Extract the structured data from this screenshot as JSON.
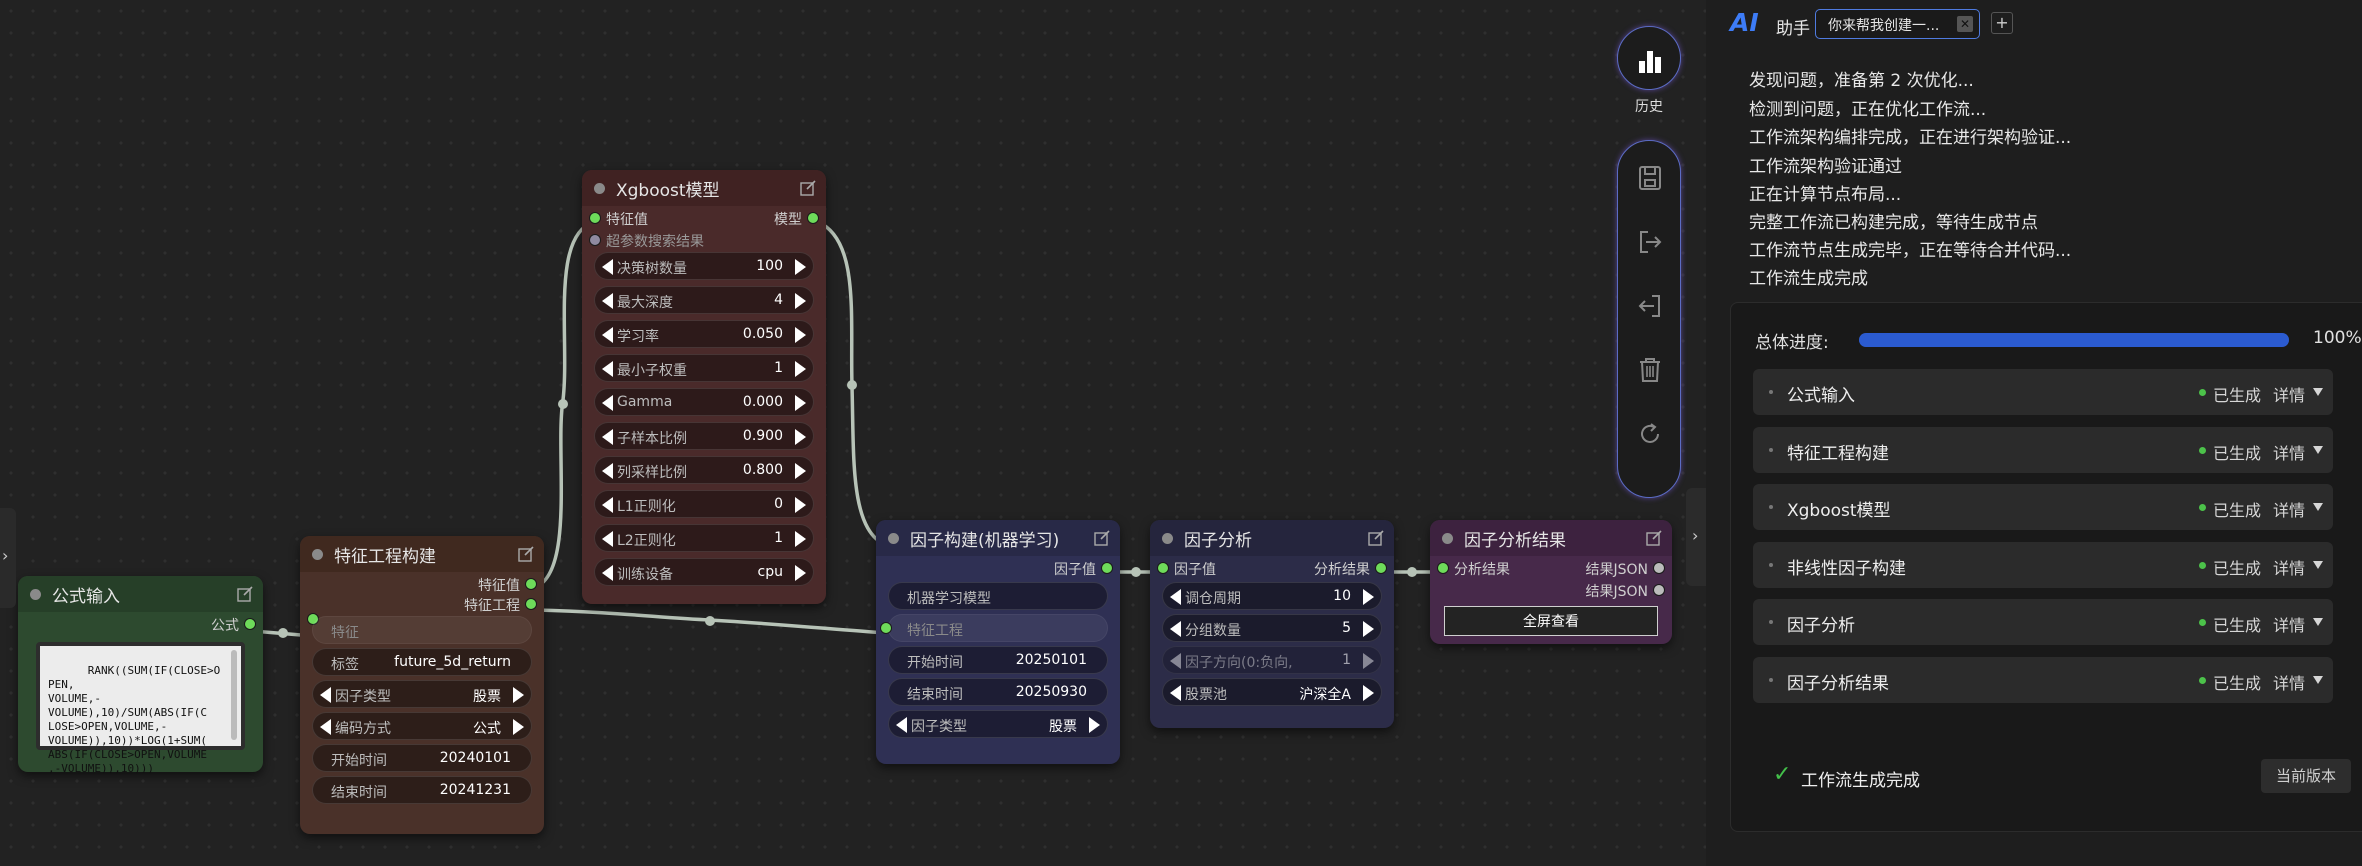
{
  "nodes": {
    "formula_input": {
      "title": "公式输入",
      "output": "公式",
      "formula": "RANK((SUM(IF(CLOSE>OPEN,\nVOLUME,-\nVOLUME),10)/SUM(ABS(IF(C\nLOSE>OPEN,VOLUME,-\nVOLUME)),10))*LOG(1+SUM(\nABS(IF(CLOSE>OPEN,VOLUME\n,-VOLUME)),10)))"
    },
    "feature_eng": {
      "title": "特征工程构建",
      "outputs": [
        "特征值",
        "特征工程"
      ],
      "widgets": [
        {
          "label": "特征",
          "value": ""
        },
        {
          "label": "标签",
          "value": "future_5d_return"
        },
        {
          "label": "因子类型",
          "value": "股票"
        },
        {
          "label": "编码方式",
          "value": "公式"
        },
        {
          "label": "开始时间",
          "value": "20240101"
        },
        {
          "label": "结束时间",
          "value": "20241231"
        }
      ]
    },
    "xgboost": {
      "title": "Xgboost模型",
      "inputs": [
        "特征值",
        "超参数搜索结果"
      ],
      "output": "模型",
      "widgets": [
        {
          "label": "决策树数量",
          "value": "100"
        },
        {
          "label": "最大深度",
          "value": "4"
        },
        {
          "label": "学习率",
          "value": "0.050"
        },
        {
          "label": "最小子权重",
          "value": "1"
        },
        {
          "label": "Gamma",
          "value": "0.000"
        },
        {
          "label": "子样本比例",
          "value": "0.900"
        },
        {
          "label": "列采样比例",
          "value": "0.800"
        },
        {
          "label": "L1正则化",
          "value": "0"
        },
        {
          "label": "L2正则化",
          "value": "1"
        },
        {
          "label": "训练设备",
          "value": "cpu"
        }
      ]
    },
    "factor_build": {
      "title": "因子构建(机器学习)",
      "output": "因子值",
      "widgets": [
        {
          "label": "机器学习模型",
          "value": ""
        },
        {
          "label": "特征工程",
          "value": ""
        },
        {
          "label": "开始时间",
          "value": "20250101"
        },
        {
          "label": "结束时间",
          "value": "20250930"
        },
        {
          "label": "因子类型",
          "value": "股票"
        }
      ]
    },
    "factor_analysis": {
      "title": "因子分析",
      "input": "因子值",
      "output": "分析结果",
      "widgets": [
        {
          "label": "调仓周期",
          "value": "10"
        },
        {
          "label": "分组数量",
          "value": "5"
        },
        {
          "label": "因子方向(0:负向,",
          "value": "1"
        },
        {
          "label": "股票池",
          "value": "沪深全A"
        }
      ]
    },
    "factor_result": {
      "title": "因子分析结果",
      "input": "分析结果",
      "outputs": [
        "结果JSON",
        "结果JSON"
      ],
      "button": "全屏查看"
    }
  },
  "toolbar": {
    "history_label": "历史",
    "icons": [
      "save-icon",
      "export-icon",
      "import-icon",
      "trash-icon",
      "refresh-icon"
    ]
  },
  "panel": {
    "logo": "AI",
    "title": "助手",
    "tab_label": "你来帮我创建一...",
    "tab_close": "✕",
    "add_tab": "+",
    "log": [
      "发现问题，准备第 2 次优化...",
      "检测到问题，正在优化工作流...",
      "工作流架构编排完成，正在进行架构验证...",
      "工作流架构验证通过",
      "正在计算节点布局...",
      "完整工作流已构建完成，等待生成节点",
      "工作流节点生成完毕，正在等待合并代码...",
      "工作流生成完成"
    ],
    "progress": {
      "label": "总体进度:",
      "value": 1.0,
      "percent_text": "100%"
    },
    "steps": [
      {
        "name": "公式输入",
        "status": "已生成",
        "detail": "详情"
      },
      {
        "name": "特征工程构建",
        "status": "已生成",
        "detail": "详情"
      },
      {
        "name": "Xgboost模型",
        "status": "已生成",
        "detail": "详情"
      },
      {
        "name": "非线性因子构建",
        "status": "已生成",
        "detail": "详情"
      },
      {
        "name": "因子分析",
        "status": "已生成",
        "detail": "详情"
      },
      {
        "name": "因子分析结果",
        "status": "已生成",
        "detail": "详情"
      }
    ],
    "done_check": "✓",
    "done_text": "工作流生成完成",
    "version_button": "当前版本"
  },
  "colors": {
    "accent": "#2b5bd0",
    "port_green": "#6edb5a",
    "status_green": "#4cc24a",
    "formula_node": "#2d4a2f",
    "feature_node": "#4a3129",
    "xgboost_node": "#4a2a2a",
    "factor_build_node": "#2f3054",
    "factor_analysis_node": "#2c2c48",
    "factor_result_node": "#47294a"
  }
}
